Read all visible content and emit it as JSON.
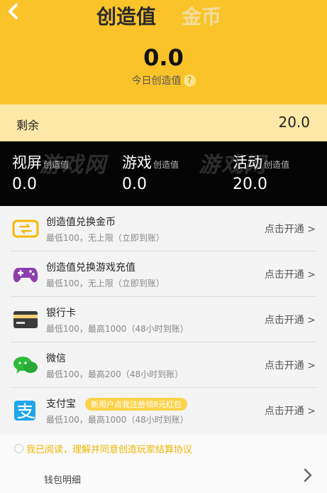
{
  "header": {
    "tab_active": "创造值",
    "tab_inactive": "金币",
    "value": "0.0",
    "label": "今日创造值",
    "help": "?"
  },
  "remain": {
    "label": "剩余",
    "value": "20.0"
  },
  "stats": [
    {
      "name": "视屏",
      "tag": "创造值",
      "value": "0.0"
    },
    {
      "name": "游戏",
      "tag": "创造值",
      "value": "0.0"
    },
    {
      "name": "活动",
      "tag": "创造值",
      "value": "20.0"
    }
  ],
  "watermark": "游戏网",
  "list": [
    {
      "title": "创造值兑换金币",
      "desc": "最低100，无上限（立即到账）",
      "action": "点击开通 >",
      "icon": "coin-exchange-icon"
    },
    {
      "title": "创造值兑换游戏充值",
      "desc": "最低100，无上限（立即到账）",
      "action": "点击开通 >",
      "icon": "gamepad-icon"
    },
    {
      "title": "银行卡",
      "desc": "最低100，最高1000（48小时到账）",
      "action": "点击开通 >",
      "icon": "bank-card-icon"
    },
    {
      "title": "微信",
      "desc": "最低100，最高200（48小时到账）",
      "action": "点击开通 >",
      "icon": "wechat-icon"
    },
    {
      "title": "支付宝",
      "desc": "最低100，最高1000（48小时到账）",
      "action": "点击开通 >",
      "icon": "alipay-icon",
      "promo": "新用户点我注册领8元红包"
    }
  ],
  "agreement": "我已阅读，理解并同意创造玩家结算协议",
  "wallet_detail": "钱包明细",
  "colors": {
    "header_bg": "#fbc32a",
    "remain_bg": "#fde8a8",
    "stats_bg": "#050505",
    "agree": "#f0b400"
  }
}
